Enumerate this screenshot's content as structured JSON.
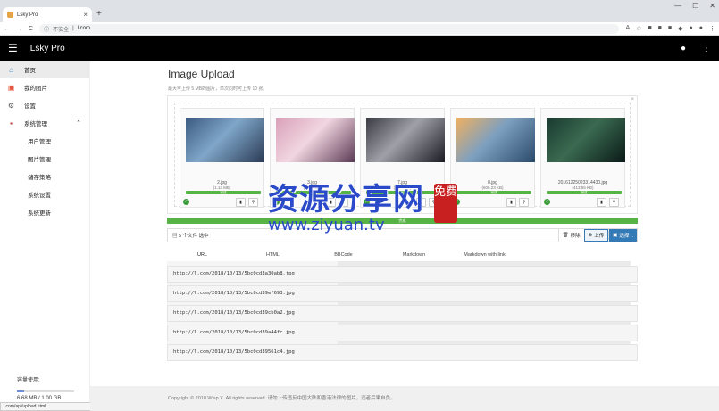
{
  "browser": {
    "tab_title": "Lsky Pro",
    "tab_close": "×",
    "new_tab": "+",
    "window_controls": [
      "—",
      "☐",
      "✕"
    ],
    "security_label": "不安全",
    "url": "l.com"
  },
  "appbar": {
    "title": "Lsky Pro"
  },
  "sidebar": {
    "items": [
      {
        "label": "首页",
        "icon": "home-icon",
        "glyph": "⌂",
        "color": "#337ab7"
      },
      {
        "label": "我的图片",
        "icon": "image-icon",
        "glyph": "▣",
        "color": "#e4573d"
      },
      {
        "label": "设置",
        "icon": "gear-icon",
        "glyph": "⚙",
        "color": "#555555"
      },
      {
        "label": "系统管理",
        "icon": "admin-icon",
        "glyph": "▪",
        "color": "#c03030"
      }
    ],
    "subitems": [
      "用户管理",
      "图片管理",
      "储存策略",
      "系统设置",
      "系统更新"
    ],
    "storage_label": "容量使用:",
    "storage_value": "6.68 MB / 1.00 GB",
    "storage_fraction": 0.0065
  },
  "status_url": "l.com/api/upload.html",
  "main": {
    "title": "Image Upload",
    "subtitle": "最大可上传 5 MB的图片，单次同时可上传 10 张。",
    "files": [
      {
        "name": "2.jpg",
        "size": "(1.13 MB)",
        "progress": "完成",
        "colors": [
          "#3a5a80",
          "#7fa6c8",
          "#2a3a55"
        ]
      },
      {
        "name": "3.jpg",
        "size": "(1.09 MB)",
        "progress": "完成",
        "colors": [
          "#d9a0b8",
          "#f1d6e0",
          "#5a3a55"
        ]
      },
      {
        "name": "7.jpg",
        "size": "(1.46 MB)",
        "progress": "完成",
        "colors": [
          "#3a3a42",
          "#a0a0a8",
          "#1a1a22"
        ]
      },
      {
        "name": "8.jpg",
        "size": "(606.23 KB)",
        "progress": "完成",
        "colors": [
          "#f0b060",
          "#7da0c0",
          "#2a4a6a"
        ]
      },
      {
        "name": "20161225023314430.jpg",
        "size": "(413.55 KB)",
        "progress": "完成",
        "colors": [
          "#1a3a30",
          "#3a6a50",
          "#0a1a18"
        ]
      }
    ],
    "overall_progress": "完成",
    "file_count": "5 个文件 选中",
    "remove_label": "移除",
    "upload_label": "上传",
    "select_label": "选择 .."
  },
  "link_tabs": [
    "URL",
    "HTML",
    "BBCode",
    "Markdown",
    "Markdown with link"
  ],
  "urls": [
    "http://l.com/2018/10/13/5bc0cd3a30ab8.jpg",
    "http://l.com/2018/10/13/5bc0cd39ef693.jpg",
    "http://l.com/2018/10/13/5bc0cd39cb0a2.jpg",
    "http://l.com/2018/10/13/5bc0cd39a44fc.jpg",
    "http://l.com/2018/10/13/5bc0cd39561c4.jpg"
  ],
  "footer": "Copyright © 2018 Wisp X. All rights reserved. 请勿上传违反中国大陆和香港法律的图片，违者后果自负。",
  "watermark": {
    "text": "资源分享网",
    "seal": "免费",
    "url": "www.ziyuan.tv"
  }
}
